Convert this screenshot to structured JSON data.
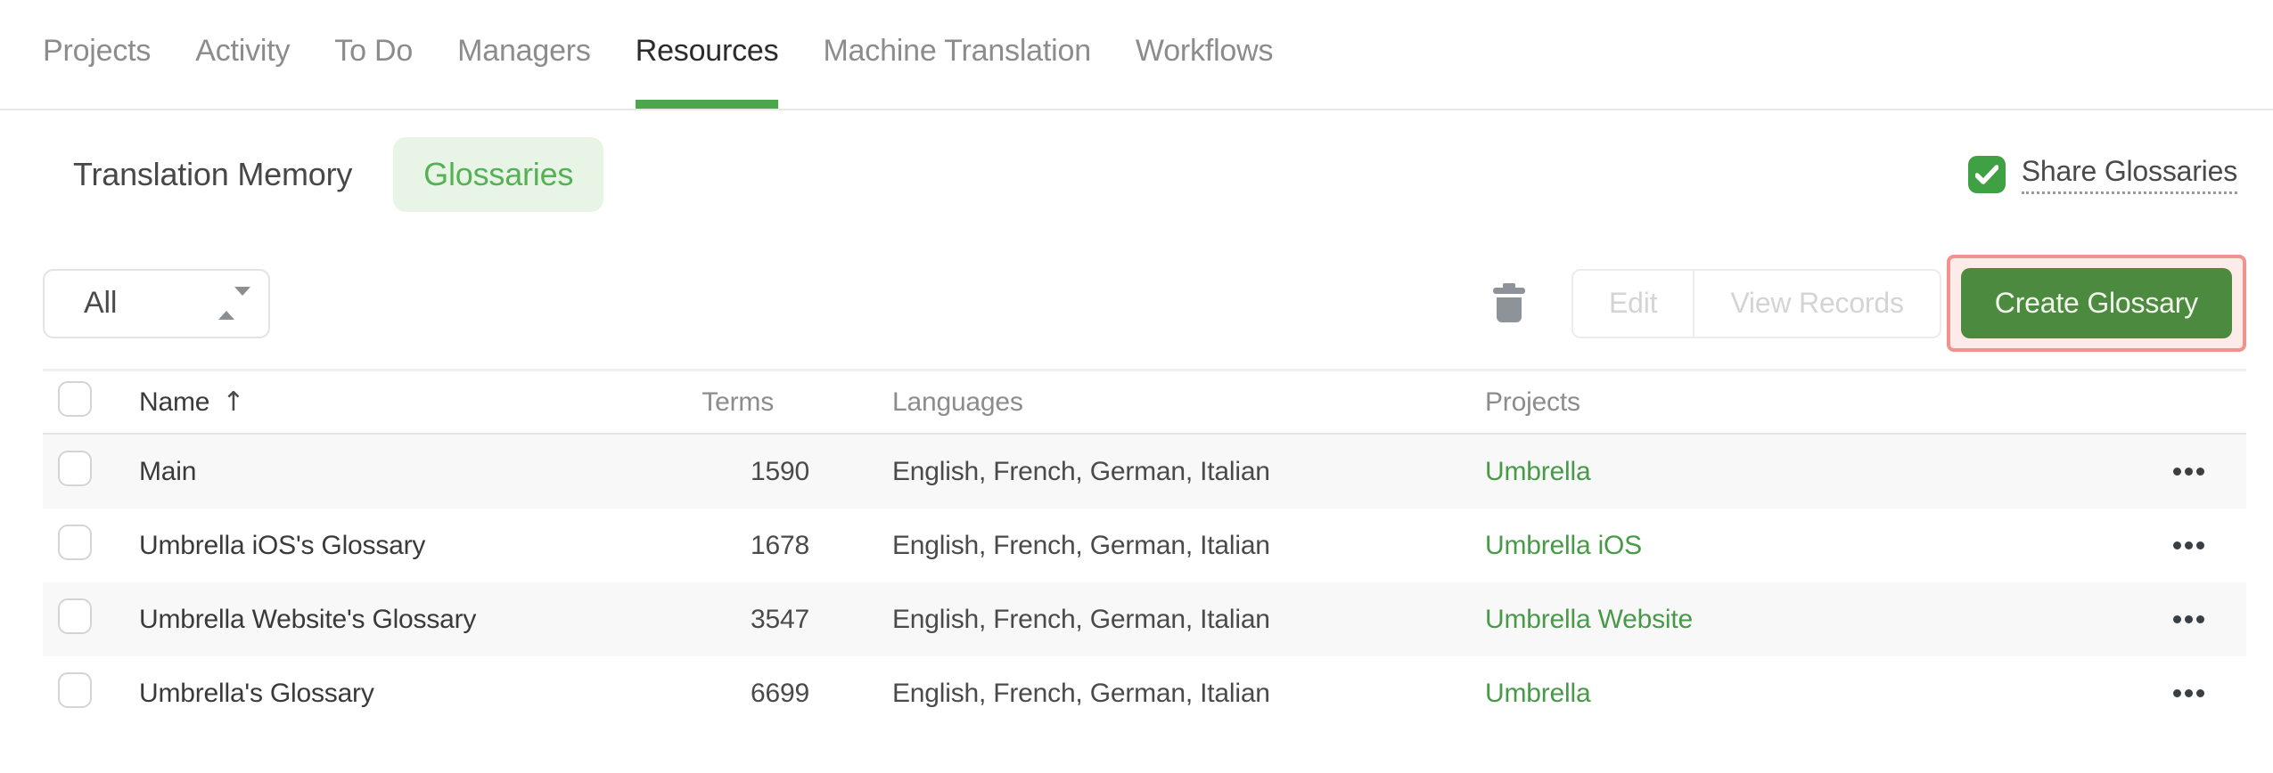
{
  "nav": {
    "tabs": [
      {
        "label": "Projects",
        "active": false
      },
      {
        "label": "Activity",
        "active": false
      },
      {
        "label": "To Do",
        "active": false
      },
      {
        "label": "Managers",
        "active": false
      },
      {
        "label": "Resources",
        "active": true
      },
      {
        "label": "Machine Translation",
        "active": false
      },
      {
        "label": "Workflows",
        "active": false
      }
    ]
  },
  "subnav": {
    "tabs": [
      {
        "label": "Translation Memory",
        "active": false
      },
      {
        "label": "Glossaries",
        "active": true
      }
    ],
    "share": {
      "label": "Share Glossaries",
      "checked": true
    }
  },
  "toolbar": {
    "filter": {
      "value": "All"
    },
    "delete_icon": "trash-icon",
    "edit_label": "Edit",
    "view_records_label": "View Records",
    "create_glossary_label": "Create Glossary",
    "create_glossary_highlighted": true
  },
  "table": {
    "columns": [
      "Name",
      "Terms",
      "Languages",
      "Projects"
    ],
    "sort": {
      "column": "Name",
      "direction": "asc",
      "indicator": "↑"
    },
    "rows": [
      {
        "name": "Main",
        "terms": "1590",
        "languages": "English, French, German, Italian",
        "project": "Umbrella"
      },
      {
        "name": "Umbrella iOS's Glossary",
        "terms": "1678",
        "languages": "English, French, German, Italian",
        "project": "Umbrella iOS"
      },
      {
        "name": "Umbrella Website's Glossary",
        "terms": "3547",
        "languages": "English, French, German, Italian",
        "project": "Umbrella Website"
      },
      {
        "name": "Umbrella's Glossary",
        "terms": "6699",
        "languages": "English, French, German, Italian",
        "project": "Umbrella"
      }
    ]
  },
  "colors": {
    "accent_green": "#4CA64C",
    "button_green": "#4C8B3F",
    "pill_bg": "#E8F5E6",
    "pill_text": "#56B156",
    "link_green": "#489948",
    "checkbox_green": "#3FA144",
    "highlight_border": "#F0938C",
    "highlight_bg": "#FCEBE8",
    "stripe": "#F8F8F8"
  }
}
